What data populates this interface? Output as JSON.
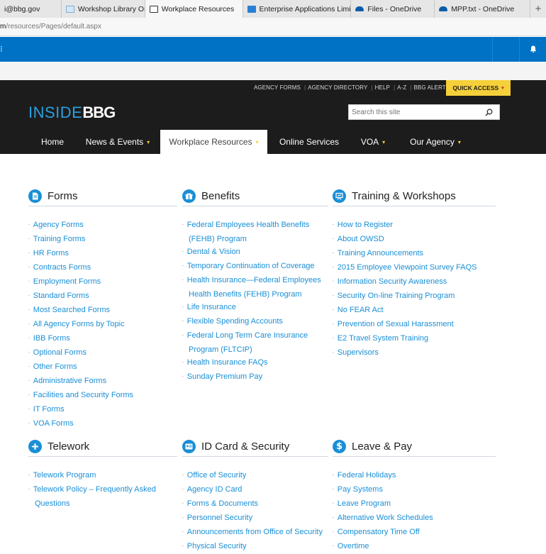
{
  "browser": {
    "tabs": [
      {
        "label": "i@bbg.gov",
        "icon": "mail-icon",
        "active": false
      },
      {
        "label": "Workshop Library On-Dema",
        "icon": "library-icon",
        "active": false
      },
      {
        "label": "Workplace Resources",
        "icon": "page-icon",
        "active": true
      },
      {
        "label": "Enterprise Applications Limi",
        "icon": "apps-icon",
        "active": false
      },
      {
        "label": "Files - OneDrive",
        "icon": "onedrive-icon",
        "active": false
      },
      {
        "label": "MPP.txt - OneDrive",
        "icon": "onedrive-icon",
        "active": false
      }
    ],
    "close_glyph": "✕",
    "new_tab_glyph": "+",
    "address": {
      "host": "m",
      "path": "/resources/Pages/default.aspx"
    }
  },
  "office_bar": {
    "bg": "#0072c6",
    "grid_glyph": "⁝",
    "bell_glyph": "🔔"
  },
  "header": {
    "utility_links": [
      "AGENCY FORMS",
      "AGENCY DIRECTORY",
      "HELP",
      "A-Z",
      "BBG ALERTS"
    ],
    "quick_access": "QUICK ACCESS",
    "logo_prefix": "INSIDE",
    "logo_suffix": "BBG",
    "search_placeholder": "Search this site",
    "nav": [
      {
        "label": "Home",
        "caret": false
      },
      {
        "label": "News & Events",
        "caret": true
      },
      {
        "label": "Workplace Resources",
        "caret": true,
        "active": true
      },
      {
        "label": "Online Services",
        "caret": false
      },
      {
        "label": "VOA",
        "caret": true
      },
      {
        "label": "Our Agency",
        "caret": true
      }
    ],
    "caret_glyph": "▾"
  },
  "sections": [
    {
      "title": "Forms",
      "icon": "document-icon",
      "links": [
        "Agency Forms",
        "Training Forms",
        "HR Forms",
        "Contracts Forms",
        "Employment Forms",
        "Standard Forms",
        "Most Searched Forms",
        "All Agency Forms by Topic",
        "IBB Forms",
        "Optional Forms",
        "Other Forms",
        "Administrative Forms",
        "Facilities and Security Forms",
        "IT Forms",
        "VOA Forms"
      ]
    },
    {
      "title": "Benefits",
      "icon": "gift-icon",
      "links": [
        "Federal Employees Health Benefits (FEHB) Program",
        "Dental & Vision",
        "Temporary Continuation of Coverage",
        "Health Insurance—Federal Employees Health Benefits (FEHB) Program",
        "Life Insurance",
        "Flexible Spending Accounts",
        "Federal Long Term Care Insurance Program (FLTCIP)",
        "Health Insurance FAQs",
        "Sunday Premium Pay"
      ]
    },
    {
      "title": "Training & Workshops",
      "icon": "presentation-icon",
      "links": [
        "How to Register",
        "About OWSD",
        "Training Announcements",
        "2015 Employee Viewpoint Survey FAQS",
        "Information Security Awareness",
        "Security On-line Training Program",
        "No FEAR Act",
        "Prevention of Sexual Harassment",
        "E2 Travel System Training",
        "Supervisors"
      ]
    },
    {
      "title": "Telework",
      "icon": "move-icon",
      "links": [
        "Telework Program",
        "Telework Policy – Frequently Asked Questions"
      ]
    },
    {
      "title": "ID Card & Security",
      "icon": "id-card-icon",
      "links": [
        "Office of Security",
        "Agency ID Card",
        "Forms & Documents",
        "Personnel Security",
        "Announcements from Office of Security",
        "Physical Security"
      ]
    },
    {
      "title": "Leave & Pay",
      "icon": "dollar-icon",
      "links": [
        "Federal Holidays",
        "Pay Systems",
        "Leave Program",
        "Alternative Work Schedules",
        "Compensatory Time Off",
        "Overtime"
      ]
    }
  ],
  "colors": {
    "link": "#1a8fd6",
    "accent": "#f6d03a",
    "header_bg": "#1c1c1c"
  }
}
